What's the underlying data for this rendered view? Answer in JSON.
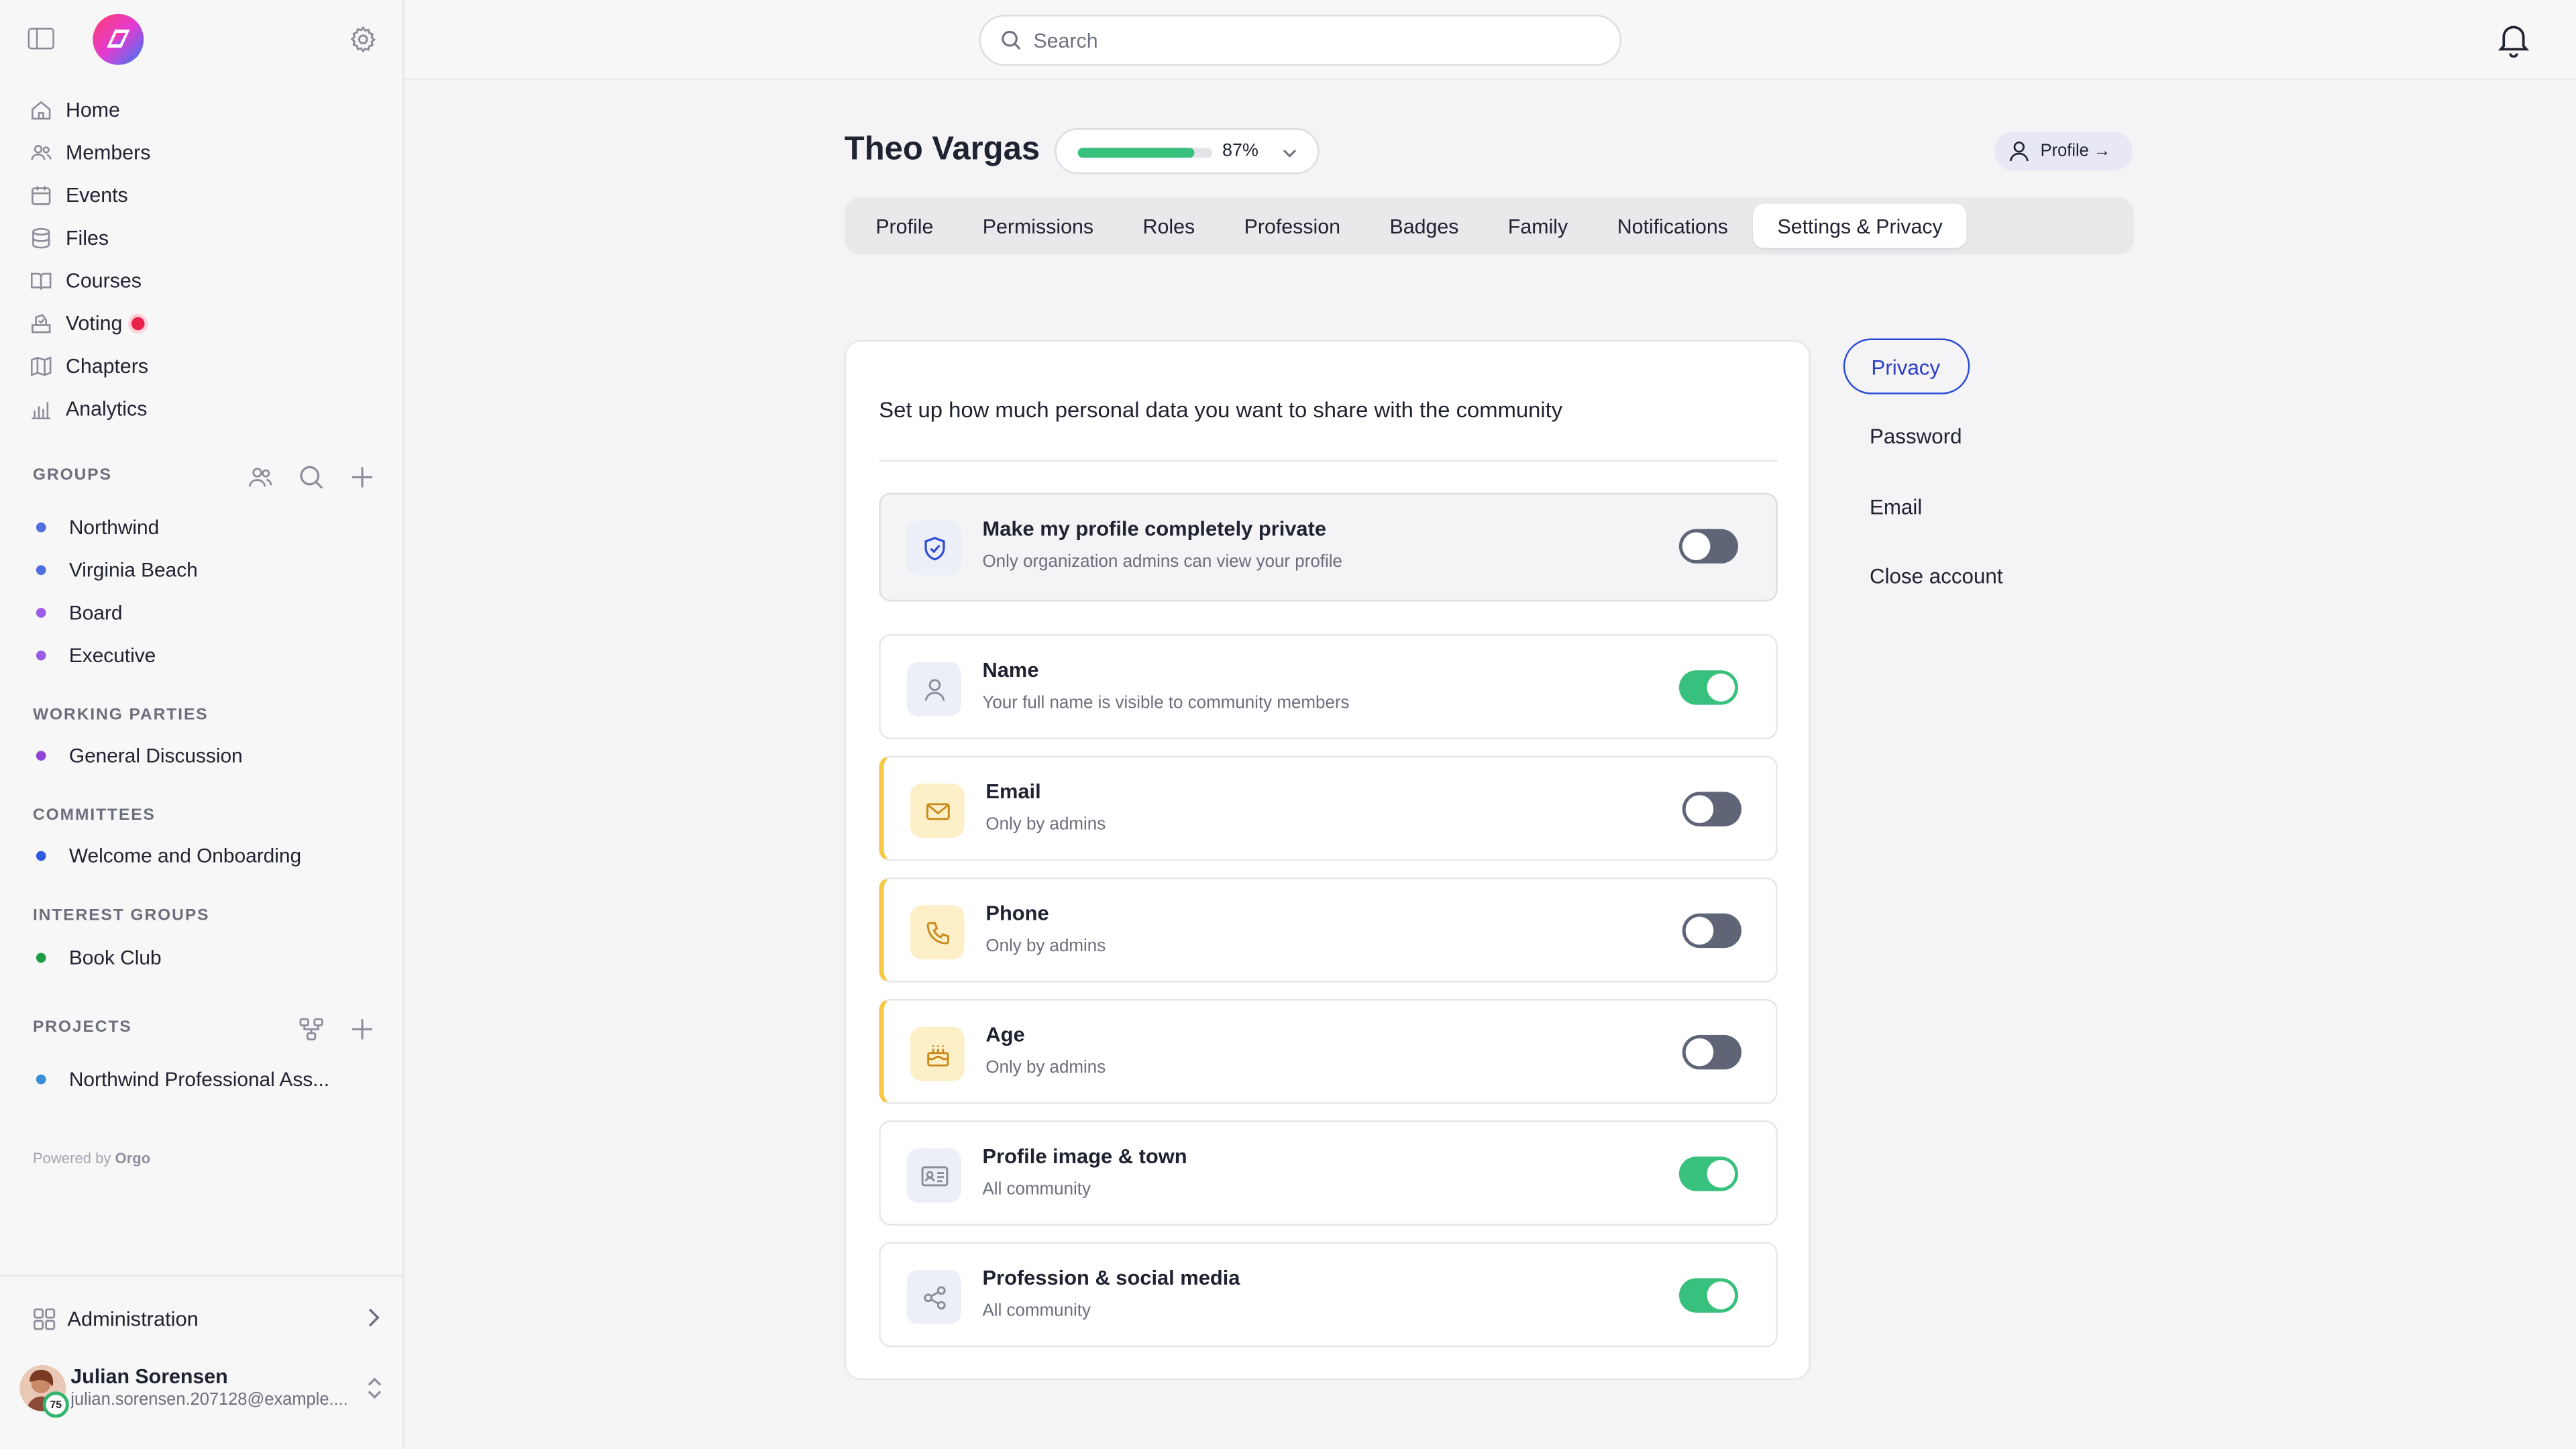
{
  "sidebar": {
    "nav": [
      {
        "label": "Home",
        "icon": "home-icon"
      },
      {
        "label": "Members",
        "icon": "members-icon"
      },
      {
        "label": "Events",
        "icon": "calendar-icon"
      },
      {
        "label": "Files",
        "icon": "database-icon"
      },
      {
        "label": "Courses",
        "icon": "book-icon"
      },
      {
        "label": "Voting",
        "icon": "ballot-icon",
        "alert": true
      },
      {
        "label": "Chapters",
        "icon": "map-icon"
      },
      {
        "label": "Analytics",
        "icon": "chart-icon"
      }
    ],
    "groups_title": "GROUPS",
    "groups": [
      {
        "label": "Northwind",
        "color": "#4f6fe0"
      },
      {
        "label": "Virginia Beach",
        "color": "#4f6fe0"
      },
      {
        "label": "Board",
        "color": "#9b5de5"
      },
      {
        "label": "Executive",
        "color": "#9b5de5"
      }
    ],
    "working_title": "WORKING PARTIES",
    "working": [
      {
        "label": "General Discussion",
        "color": "#8e44d9"
      }
    ],
    "committees_title": "COMMITTEES",
    "committees": [
      {
        "label": "Welcome and Onboarding",
        "color": "#2f5be0"
      }
    ],
    "interest_title": "INTEREST GROUPS",
    "interest": [
      {
        "label": "Book Club",
        "color": "#1f9e4a"
      }
    ],
    "projects_title": "PROJECTS",
    "projects": [
      {
        "label": "Northwind Professional Ass...",
        "color": "#3a8ed8"
      }
    ],
    "powered_prefix": "Powered by",
    "powered_brand": "Orgo",
    "admin_label": "Administration",
    "user": {
      "name": "Julian Sorensen",
      "email": "julian.sorensen.207128@example....",
      "badge": "75"
    }
  },
  "header": {
    "search_placeholder": "Search"
  },
  "profile": {
    "name": "Theo Vargas",
    "completion_pct": 87,
    "completion_label": "87%",
    "profile_button": "Profile →"
  },
  "tabs": [
    "Profile",
    "Permissions",
    "Roles",
    "Profession",
    "Badges",
    "Family",
    "Notifications",
    "Settings & Privacy"
  ],
  "active_tab": "Settings & Privacy",
  "privacy": {
    "heading": "Set up how much personal data you want to share with the community",
    "rows": [
      {
        "title": "Make my profile completely private",
        "subtitle": "Only organization admins can view your profile",
        "on": false,
        "icon": "shield-icon"
      },
      {
        "title": "Name",
        "subtitle": "Your full name is visible to community members",
        "on": true,
        "icon": "user-icon"
      },
      {
        "title": "Email",
        "subtitle": "Only by admins",
        "on": false,
        "icon": "mail-icon"
      },
      {
        "title": "Phone",
        "subtitle": "Only by admins",
        "on": false,
        "icon": "phone-icon"
      },
      {
        "title": "Age",
        "subtitle": "Only by admins",
        "on": false,
        "icon": "cake-icon"
      },
      {
        "title": "Profile image & town",
        "subtitle": "All community",
        "on": true,
        "icon": "id-card-icon"
      },
      {
        "title": "Profession & social media",
        "subtitle": "All community",
        "on": true,
        "icon": "share-icon"
      }
    ]
  },
  "settings_menu": [
    "Privacy",
    "Password",
    "Email",
    "Close account"
  ],
  "colors": {
    "accent": "#2b4bd6",
    "toggle_on": "#38c17c",
    "toggle_off": "#5f6577",
    "warn": "#f7c842"
  }
}
